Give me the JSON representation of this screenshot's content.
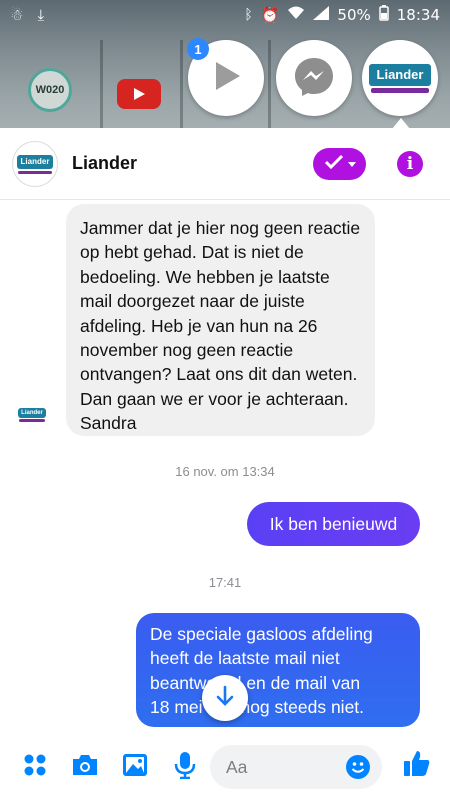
{
  "status_bar": {
    "battery": "50%",
    "time": "18:34"
  },
  "background_apps": {
    "w020_label": "W020"
  },
  "chat_heads": {
    "badge_count": "1"
  },
  "header": {
    "contact_name": "Liander",
    "logo_text": "Liander"
  },
  "messages": {
    "incoming_text": "Jammer dat je hier nog geen reactie op hebt gehad. Dat is niet de bedoeling. We hebben je laatste mail doorgezet naar de juiste afdeling. Heb je van hun na 26 november nog geen reactie ontvangen? Laat ons dit dan weten. Dan gaan we er voor je achteraan. Sandra",
    "timestamp_1": "16 nov. om 13:34",
    "outgoing_1": "Ik ben benieuwd",
    "timestamp_2": "17:41",
    "outgoing_2_lines": [
      "De speciale gasloos afdeling",
      "heeft de laatste mail niet",
      "beantwoord en de mail van",
      "18 mei ook nog steeds niet."
    ]
  },
  "composer": {
    "placeholder": "Aa"
  },
  "colors": {
    "accent_purple": "#b010e0",
    "outgoing_bubble": "#3a5cf0",
    "messenger_blue": "#0084ff"
  },
  "icons": [
    "apps-icon",
    "camera-icon",
    "gallery-icon",
    "microphone-icon",
    "emoji-icon",
    "thumbs-up-icon",
    "arrow-down-icon",
    "check-icon",
    "info-icon",
    "play-icon",
    "messenger-icon"
  ]
}
